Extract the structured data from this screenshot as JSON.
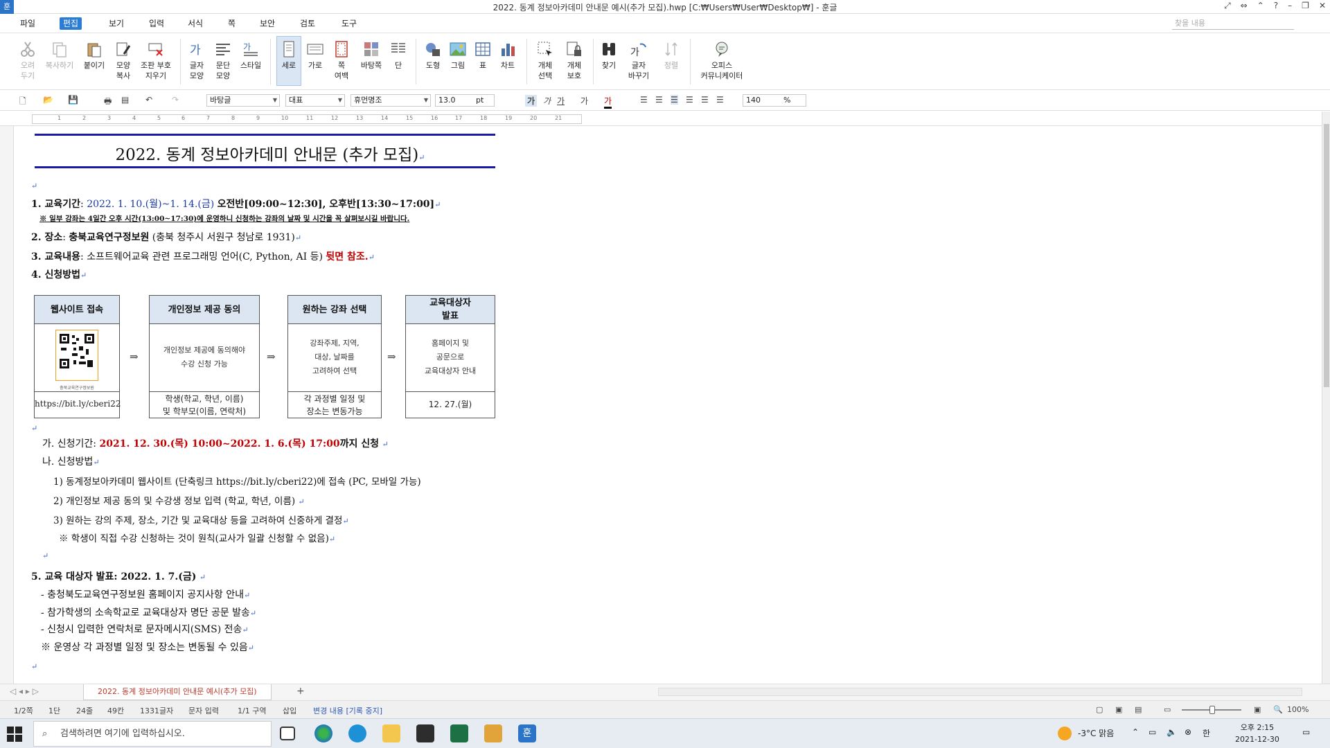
{
  "window": {
    "title": "2022. 동계 정보아카데미 안내문 예시(추가 모집).hwp [C:₩Users₩User₩Desktop₩] - 훈글",
    "app_logo": "훈"
  },
  "menu": {
    "file": "파일",
    "items": [
      "편집",
      "보기",
      "입력",
      "서식",
      "쪽",
      "보안",
      "검토",
      "도구"
    ],
    "search_placeholder": "찾을 내용"
  },
  "ribbon": {
    "cut": "오려\n두기",
    "copy": "복사하기",
    "paste": "붙이기",
    "format_copy": "모양\n복사",
    "erase_code": "조판 부호\n지우기",
    "char_shape": "글자\n모양",
    "para_shape": "문단\n모양",
    "style": "스타일",
    "portrait": "세로",
    "landscape": "가로",
    "page_margin": "쪽\n여백",
    "border": "바탕쪽",
    "column": "단",
    "shape": "도형",
    "picture": "그림",
    "table": "표",
    "chart": "차트",
    "select_obj": "개체\n선택",
    "protect_obj": "개체\n보호",
    "find": "찾기",
    "replace": "글자\n바꾸기",
    "sort": "정렬",
    "office_comm": "오피스\n커뮤니케이터"
  },
  "formatbar": {
    "style_name": "바탕글",
    "lang": "대표",
    "font": "휴먼명조",
    "size": "13.0",
    "unit": "pt",
    "bold": "가",
    "italic": "가",
    "underline": "가",
    "strike": "가",
    "font_color": "가",
    "zoom": "140",
    "zoom_unit": "%"
  },
  "ruler_marks": [
    "1",
    "2",
    "3",
    "4",
    "5",
    "6",
    "7",
    "8",
    "9",
    "10",
    "11",
    "12",
    "13",
    "14",
    "15",
    "16",
    "17",
    "18",
    "19",
    "20",
    "21"
  ],
  "doc": {
    "title": "2022. 동계 정보아카데미 안내문 (추가 모집)",
    "s1_label": "1. 교육기간",
    "s1_date": "2022. 1. 10.(월)~1. 14.(금)",
    "s1_rest": "오전반[09:00~12:30], 오후반[13:30~17:00]",
    "s1_note": "※ 일부 강좌는 4일간 오후 시간(13:00~17:30)에 운영하니 신청하는 강좌의 날짜 및 시간을 꼭 살펴보시길 바랍니다.",
    "s2_label": "2. 장소",
    "s2_place": "충북교육연구정보원",
    "s2_addr": "(충북 청주시 서원구 청남로 1931)",
    "s3_label": "3. 교육내용",
    "s3_text": "소프트웨어교육 관련 프로그래밍 언어(C, Python, AI 등)",
    "s3_red": "뒷면 참조.",
    "s4_label": "4. 신청방법",
    "steps": [
      {
        "head": "웹사이트 접속",
        "body": "",
        "foot": "https://bit.ly/cberi22"
      },
      {
        "head": "개인정보 제공 동의",
        "body": "개인정보 제공에 동의해야\n수강 신청 가능",
        "foot": "학생(학교, 학년, 이름)\n및 학부모(이름, 연락처)"
      },
      {
        "head": "원하는 강좌 선택",
        "body": "강좌주제, 지역,\n대상, 날짜를\n고려하여 선택",
        "foot": "각 과정별 일정 및\n장소는 변동가능"
      },
      {
        "head": "교육대상자\n발표",
        "body": "홈페이지 및\n공문으로\n교육대상자 안내",
        "foot": "12. 27.(월)"
      }
    ],
    "qr_caption": "충북교육연구정보원",
    "ga_label": "가. 신청기간:",
    "ga_date": "2021. 12. 30.(목) 10:00~2022. 1. 6.(목) 17:00",
    "ga_rest": "까지 신청",
    "na_label": "나. 신청방법",
    "na_1": "1) 동계정보아카데미 웹사이트 (단축링크 https://bit.ly/cberi22)에 접속 (PC, 모바일 가능)",
    "na_2": "2) 개인정보 제공 동의 및 수강생 정보 입력 (학교, 학년, 이름)",
    "na_3": "3) 원하는 강의 주제, 장소, 기간 및 교육대상 등을 고려하여 신중하게 결정",
    "na_note": "※ 학생이 직접 수강 신청하는 것이 원칙(교사가 일괄 신청할 수 없음)",
    "s5_label": "5. 교육 대상자 발표: 2022. 1. 7.(금)",
    "s5_1": "- 충청북도교육연구정보원 홈페이지 공지사항 안내",
    "s5_2": "- 참가학생의 소속학교로 교육대상자 명단 공문 발송",
    "s5_3": "- 신청시 입력한 연락처로 문자메시지(SMS) 전송",
    "s5_note": "※ 운영상 각 과정별 일정 및 장소는 변동될 수 있음"
  },
  "tabbar": {
    "tab": "2022. 동계 정보아카데미 안내문 예시(추가 모집)"
  },
  "status": {
    "page": "1/2쪽",
    "col": "1단",
    "line": "24줄",
    "pos": "49칸",
    "chars": "1331글자",
    "mode": "문자 입력",
    "section": "1/1 구역",
    "insert": "삽입",
    "track": "변경 내용 [기록 중지]",
    "zoom": "100%"
  },
  "taskbar": {
    "search_placeholder": "검색하려면 여기에 입력하십시오.",
    "weather": "-3°C 맑음",
    "ime": "한",
    "time": "오후 2:15",
    "date": "2021-12-30"
  },
  "colors": {
    "accent": "#2b7cd3",
    "title_rule": "#1a1aa6",
    "emphasis_blue": "#1a3aa6",
    "emphasis_red": "#c00000",
    "box_header": "#dce6f2"
  }
}
